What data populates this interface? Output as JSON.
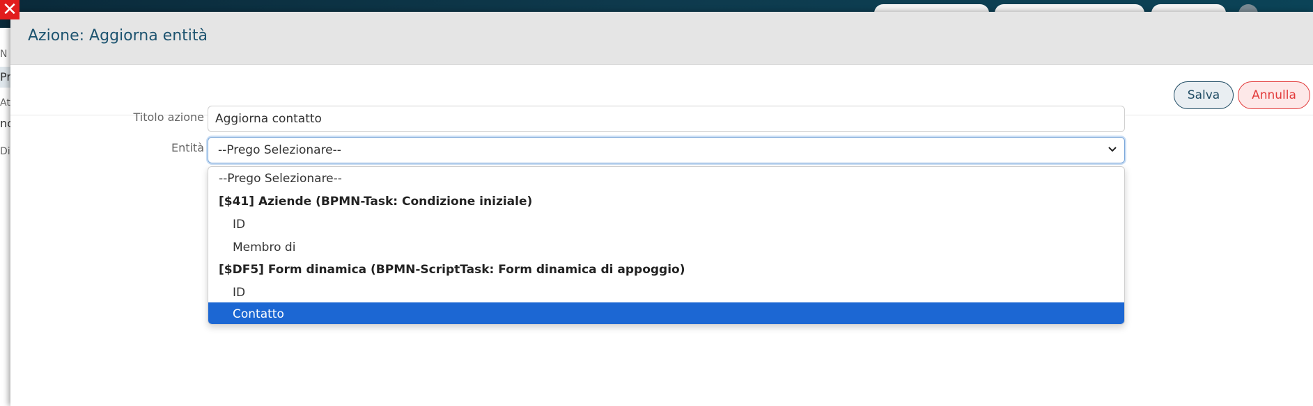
{
  "background": {
    "left_fragments": [
      "N",
      "Pr",
      "At",
      "nc",
      "Di"
    ]
  },
  "modal": {
    "title": "Azione: Aggiorna entità"
  },
  "toolbar": {
    "save_label": "Salva",
    "cancel_label": "Annulla"
  },
  "form": {
    "title_label": "Titolo azione",
    "title_value": "Aggiorna contatto",
    "entity_label": "Entità",
    "entity_value": "--Prego Selezionare--"
  },
  "dropdown": {
    "placeholder": "--Prego Selezionare--",
    "groups": [
      {
        "label": "[$41] Aziende (BPMN-Task: Condizione iniziale)",
        "items": [
          "ID",
          "Membro di"
        ]
      },
      {
        "label": "[$DF5] Form dinamica (BPMN-ScriptTask: Form dinamica di appoggio)",
        "items": [
          "ID",
          "Contatto"
        ]
      }
    ],
    "selected_item": "Contatto"
  },
  "colors": {
    "accent": "#1e5470",
    "selected": "#1c67d3",
    "cancel": "#e23b3b"
  }
}
